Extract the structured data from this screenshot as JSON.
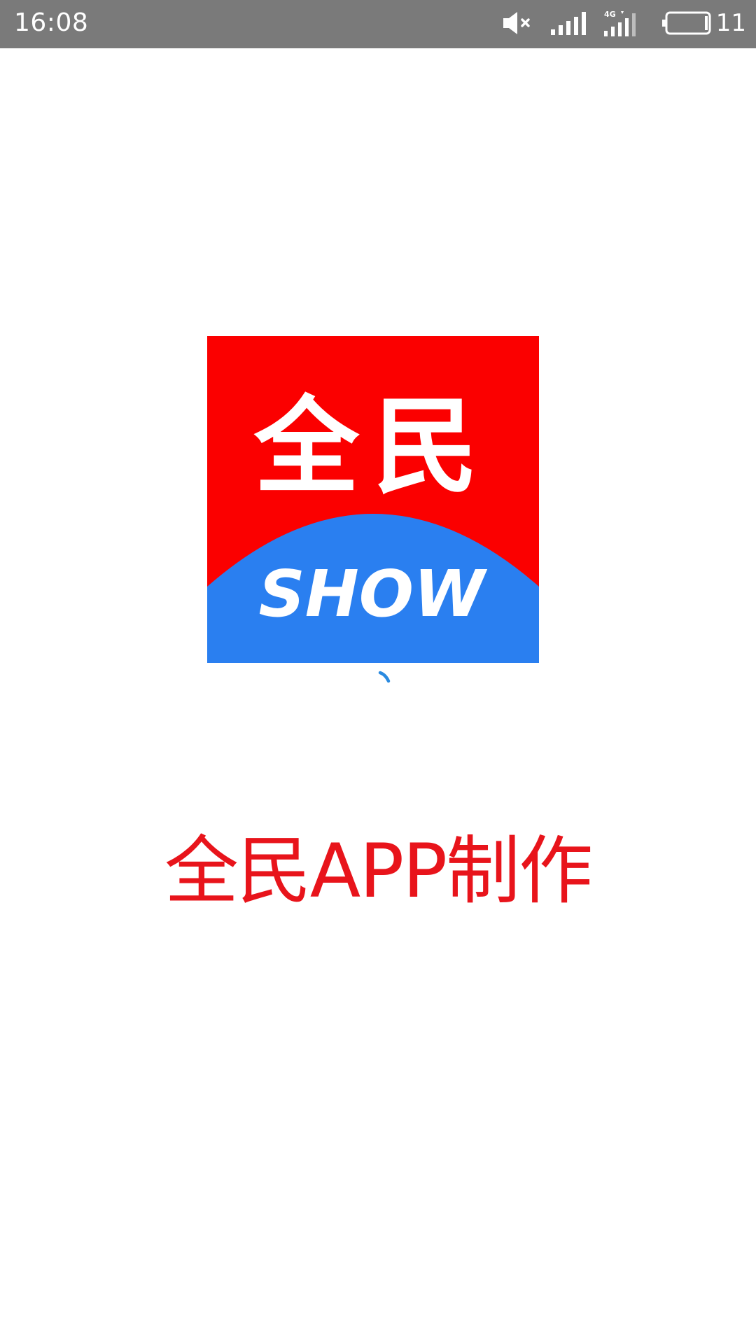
{
  "status_bar": {
    "time": "16:08",
    "network_type": "4G",
    "battery_level": "11",
    "icons": [
      "mute-icon",
      "signal-icon",
      "4g-signal-icon",
      "battery-icon"
    ]
  },
  "splash": {
    "logo": {
      "top_text": "全民",
      "bottom_text": "SHOW",
      "top_color": "#fb0000",
      "bottom_color": "#2a7ff0"
    },
    "loading_indicator": "loading-spinner-icon",
    "app_name": "全民APP制作",
    "app_name_color": "#e8141b"
  }
}
